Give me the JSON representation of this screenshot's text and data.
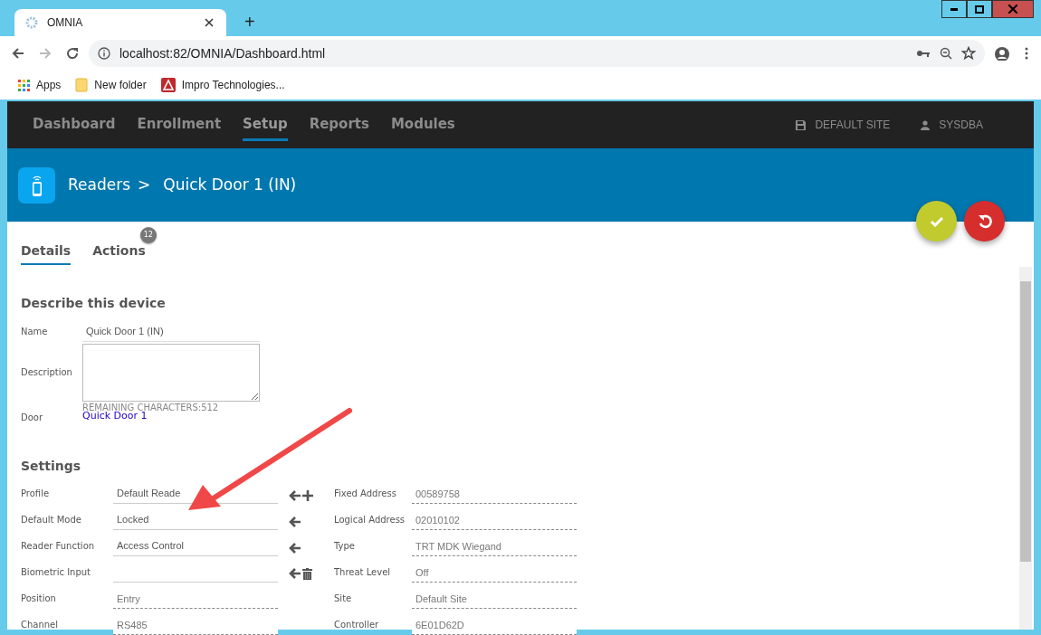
{
  "browser": {
    "tab_title": "OMNIA",
    "new_tab": "+",
    "url": "localhost:82/OMNIA/Dashboard.html",
    "bookmarks": [
      {
        "label": "Apps",
        "kind": "apps"
      },
      {
        "label": "New folder",
        "kind": "folder"
      },
      {
        "label": "Impro Technologies...",
        "kind": "site"
      }
    ]
  },
  "nav": {
    "items": [
      {
        "label": "Dashboard",
        "selected": false
      },
      {
        "label": "Enrollment",
        "selected": false
      },
      {
        "label": "Setup",
        "selected": true
      },
      {
        "label": "Reports",
        "selected": false
      },
      {
        "label": "Modules",
        "selected": false
      }
    ],
    "site": "DEFAULT SITE",
    "user": "SYSDBA"
  },
  "header": {
    "breadcrumb": "Readers",
    "separator": ">",
    "title": "Quick Door 1 (IN)"
  },
  "tabs": [
    {
      "label": "Details",
      "selected": true
    },
    {
      "label": "Actions",
      "selected": false,
      "badge": "12"
    }
  ],
  "describe": {
    "heading": "Describe this device",
    "name_label": "Name",
    "name_value": "Quick Door 1 (IN)",
    "description_label": "Description",
    "remaining": "REMAINING CHARACTERS:512",
    "door_label": "Door",
    "door_link": "Quick Door 1"
  },
  "settings": {
    "heading": "Settings",
    "left": [
      {
        "label": "Profile",
        "value": "Default Reade",
        "kind": "editable",
        "revert_button": true,
        "add_button": true,
        "delete_button": false
      },
      {
        "label": "Default Mode",
        "value": "Locked",
        "kind": "editable",
        "revert_button": true,
        "add_button": false,
        "delete_button": false
      },
      {
        "label": "Reader Function",
        "value": "Access Control",
        "kind": "editable",
        "revert_button": true,
        "add_button": false,
        "delete_button": false
      },
      {
        "label": "Biometric Input",
        "kind": "editable",
        "revert_button": true,
        "add_button": false,
        "delete_button": true
      },
      {
        "label": "Position",
        "value": "Entry",
        "kind": "readonly",
        "revert_button": false,
        "add_button": false,
        "delete_button": false
      },
      {
        "label": "Channel",
        "value": "RS485",
        "kind": "readonly",
        "revert_button": false,
        "add_button": false,
        "delete_button": false
      }
    ],
    "right": [
      {
        "label": "Fixed Address",
        "value": "00589758",
        "kind": "readonly"
      },
      {
        "label": "Logical Address",
        "value": "02010102",
        "kind": "readonly"
      },
      {
        "label": "Type",
        "value": "TRT MDK Wiegand",
        "kind": "readonly"
      },
      {
        "label": "Threat Level",
        "value": "Off",
        "kind": "readonly"
      },
      {
        "label": "Site",
        "value": "Default Site",
        "kind": "readonly"
      },
      {
        "label": "Controller",
        "value": "6E01D62D",
        "kind": "readonly"
      }
    ]
  }
}
